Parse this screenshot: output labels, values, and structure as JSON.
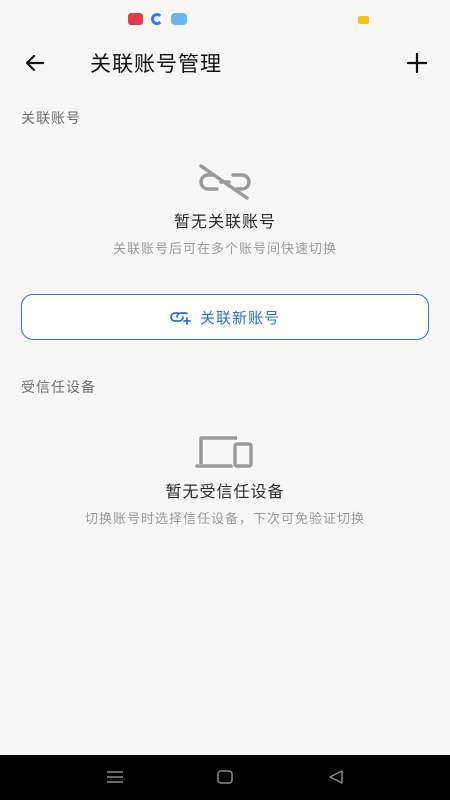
{
  "header": {
    "title": "关联账号管理",
    "back_icon": "arrow-left-icon",
    "add_icon": "plus-icon"
  },
  "linked_accounts": {
    "section_label": "关联账号",
    "empty_icon": "unlink-icon",
    "empty_title": "暂无关联账号",
    "empty_desc": "关联账号后可在多个账号间快速切换",
    "button_icon": "link-add-icon",
    "button_label": "关联新账号"
  },
  "trusted_devices": {
    "section_label": "受信任设备",
    "empty_icon": "devices-icon",
    "empty_title": "暂无受信任设备",
    "empty_desc": "切换账号时选择信任设备，下次可免验证切换"
  },
  "nav": {
    "menu_icon": "menu-icon",
    "home_icon": "square-home-icon",
    "back_icon": "triangle-back-icon"
  },
  "colors": {
    "accent": "#2e6fd8",
    "background": "#f7f7f7",
    "muted_text": "#9a9a9a"
  }
}
